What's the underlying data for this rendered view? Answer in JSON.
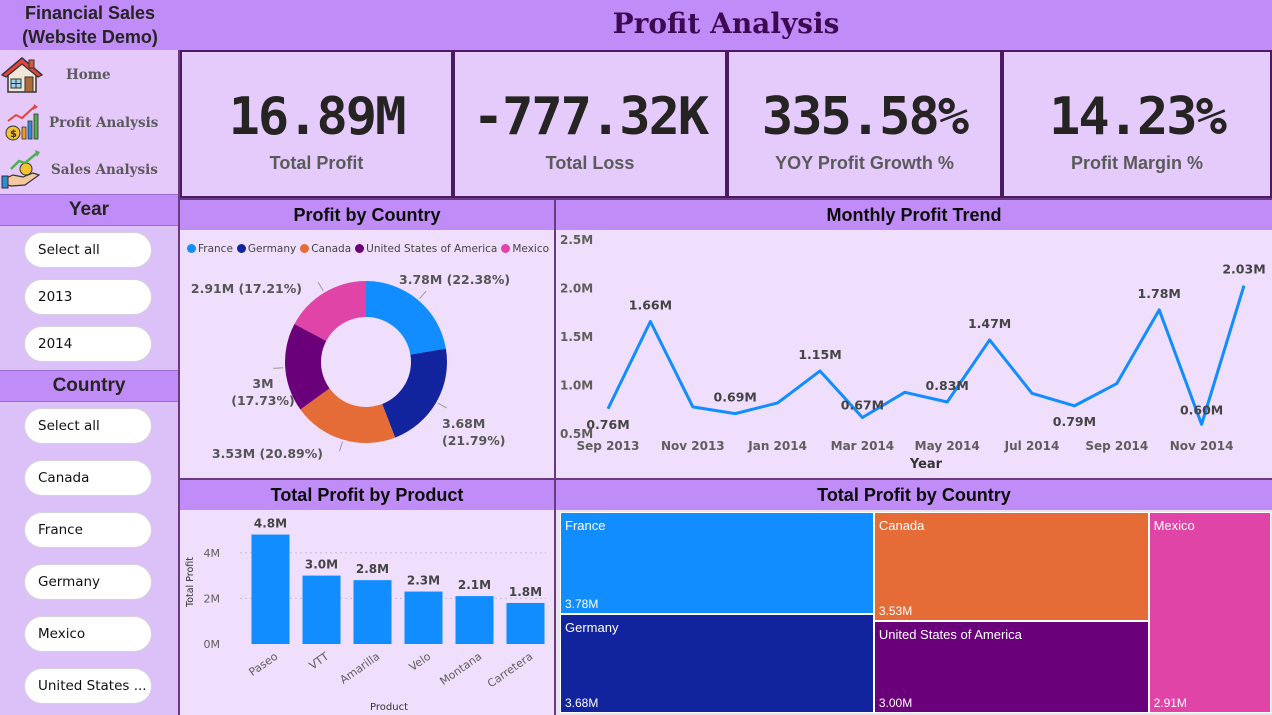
{
  "app": {
    "title_line1": "Financial Sales",
    "title_line2": "(Website Demo)",
    "page_title": "Profit Analysis"
  },
  "nav": [
    {
      "label": "Home",
      "icon": "house-icon"
    },
    {
      "label": "Profit Analysis",
      "icon": "profit-chart-icon"
    },
    {
      "label": "Sales Analysis",
      "icon": "sales-hand-icon"
    }
  ],
  "year_slicer": {
    "title": "Year",
    "options": [
      "Select all",
      "2013",
      "2014"
    ]
  },
  "country_slicer": {
    "title": "Country",
    "options": [
      "Select all",
      "Canada",
      "France",
      "Germany",
      "Mexico",
      "United States ..."
    ]
  },
  "kpis": [
    {
      "value": "16.89M",
      "label": "Total Profit"
    },
    {
      "value": "-777.32K",
      "label": "Total Loss"
    },
    {
      "value": "335.58%",
      "label": "YOY Profit Growth %"
    },
    {
      "value": "14.23%",
      "label": "Profit Margin %"
    }
  ],
  "colors": {
    "france": "#118dff",
    "germany": "#12239e",
    "canada": "#e66c37",
    "usa": "#6b007b",
    "mexico": "#e044a7",
    "accent": "#c08cf8"
  },
  "chart_data": [
    {
      "type": "pie",
      "title": "Profit by Country",
      "categories": [
        "France",
        "Germany",
        "Canada",
        "United States of America",
        "Mexico"
      ],
      "values": [
        3.78,
        3.68,
        3.53,
        3.0,
        2.91
      ],
      "labels": [
        "3.78M (22.38%)",
        "3.68M (21.79%)",
        "3.53M (20.89%)",
        "3M (17.73%)",
        "2.91M (17.21%)"
      ],
      "unit": "M",
      "legend": "top"
    },
    {
      "type": "line",
      "title": "Monthly Profit Trend",
      "xlabel": "Year",
      "x": [
        "Sep 2013",
        "Oct 2013",
        "Nov 2013",
        "Dec 2013",
        "Jan 2014",
        "Feb 2014",
        "Mar 2014",
        "Apr 2014",
        "May 2014",
        "Jun 2014",
        "Jul 2014",
        "Aug 2014",
        "Sep 2014",
        "Oct 2014",
        "Nov 2014",
        "Dec 2014"
      ],
      "values": [
        0.76,
        1.66,
        0.78,
        0.71,
        0.82,
        1.15,
        0.67,
        0.93,
        0.83,
        1.47,
        0.92,
        0.79,
        1.02,
        1.78,
        0.6,
        2.03
      ],
      "data_labels": [
        "0.76M",
        "1.66M",
        "",
        "0.69M",
        "",
        "1.15M",
        "0.67M",
        "",
        "0.83M",
        "1.47M",
        "",
        "0.79M",
        "",
        "1.78M",
        "0.60M",
        "2.03M"
      ],
      "xticks": [
        "Sep 2013",
        "Nov 2013",
        "Jan 2014",
        "Mar 2014",
        "May 2014",
        "Jul 2014",
        "Sep 2014",
        "Nov 2014"
      ],
      "yticks": [
        "0.5M",
        "1.0M",
        "1.5M",
        "2.0M",
        "2.5M"
      ],
      "ylim": [
        0.5,
        2.5
      ]
    },
    {
      "type": "bar",
      "title": "Total Profit by Product",
      "xlabel": "Product",
      "ylabel": "Total Profit",
      "categories": [
        "Paseo",
        "VTT",
        "Amarilla",
        "Velo",
        "Montana",
        "Carretera"
      ],
      "values": [
        4.8,
        3.0,
        2.8,
        2.3,
        2.1,
        1.8
      ],
      "data_labels": [
        "4.8M",
        "3.0M",
        "2.8M",
        "2.3M",
        "2.1M",
        "1.8M"
      ],
      "yticks": [
        "0M",
        "2M",
        "4M"
      ],
      "ylim": [
        0,
        5
      ]
    },
    {
      "type": "treemap",
      "title": "Total Profit by Country",
      "categories": [
        "France",
        "Germany",
        "Canada",
        "United States of America",
        "Mexico"
      ],
      "values": [
        3.78,
        3.68,
        3.53,
        3.0,
        2.91
      ],
      "value_labels": [
        "3.78M",
        "3.68M",
        "3.53M",
        "3.00M",
        "2.91M"
      ]
    }
  ]
}
